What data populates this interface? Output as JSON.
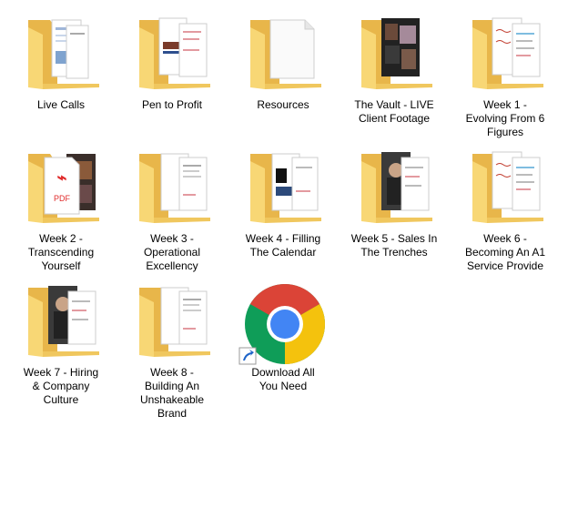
{
  "items": [
    {
      "label": "Live Calls",
      "type": "folder",
      "preview": "docs-blue"
    },
    {
      "label": "Pen to Profit",
      "type": "folder",
      "preview": "docs-red"
    },
    {
      "label": "Resources",
      "type": "folder",
      "preview": "blank-doc"
    },
    {
      "label": "The Vault - LIVE\nClient Footage",
      "type": "folder",
      "preview": "video-dark"
    },
    {
      "label": "Week 1 -\nEvolving From 6\nFigures",
      "type": "folder",
      "preview": "docs-handwriting"
    },
    {
      "label": "Week 2 -\nTranscending\nYourself",
      "type": "folder",
      "preview": "pdf"
    },
    {
      "label": "Week 3 -\nOperational\nExcellency",
      "type": "folder",
      "preview": "docs-plain"
    },
    {
      "label": "Week 4 - Filling\nThe Calendar",
      "type": "folder",
      "preview": "docs-screens"
    },
    {
      "label": "Week 5 - Sales In\nThe Trenches",
      "type": "folder",
      "preview": "person-photo"
    },
    {
      "label": "Week 6 -\nBecoming An A1\nService Provide",
      "type": "folder",
      "preview": "docs-handwriting"
    },
    {
      "label": "Week 7 - Hiring\n& Company\nCulture",
      "type": "folder",
      "preview": "person-photo"
    },
    {
      "label": "Week 8 -\nBuilding An\nUnshakeable\nBrand",
      "type": "folder",
      "preview": "docs-plain"
    },
    {
      "label": "Download All\nYou Need",
      "type": "shortcut",
      "preview": "chrome-icon"
    }
  ],
  "colors": {
    "folder_back": "#e8b64a",
    "folder_front": "#f8d775",
    "folder_front_edge": "#f0c75e",
    "chrome_red": "#db4437",
    "chrome_yellow": "#f4c20d",
    "chrome_green": "#0f9d58",
    "chrome_blue": "#4285f4"
  }
}
